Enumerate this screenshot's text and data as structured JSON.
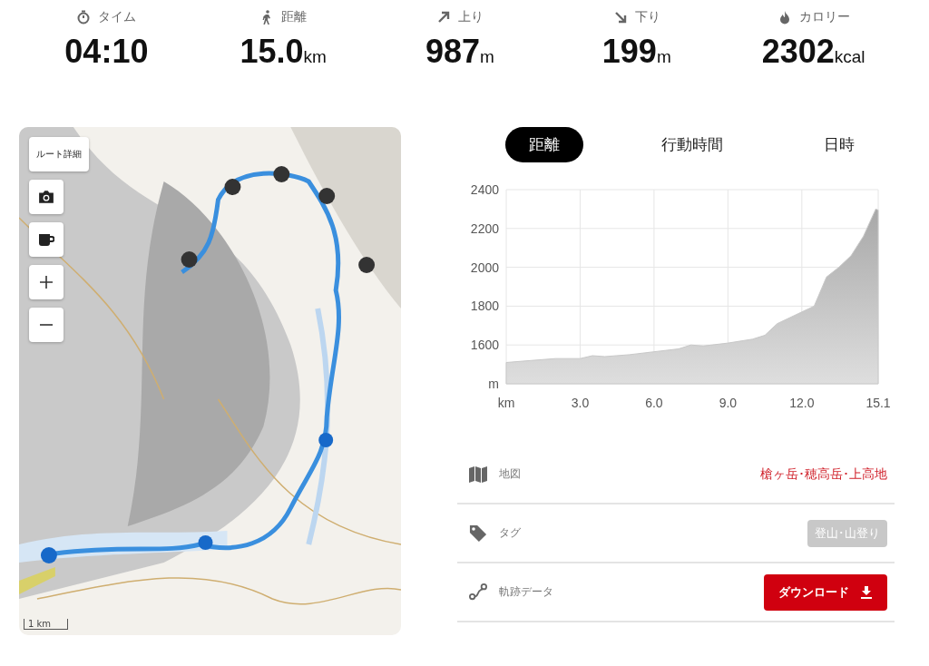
{
  "stats": [
    {
      "kind": "time",
      "label": "タイム",
      "value": "04:10"
    },
    {
      "kind": "distance",
      "label": "距離",
      "value": "15.0",
      "unit": "km"
    },
    {
      "kind": "ascent",
      "label": "上り",
      "value": "987",
      "unit": "m"
    },
    {
      "kind": "descent",
      "label": "下り",
      "value": "199",
      "unit": "m"
    },
    {
      "kind": "calorie",
      "label": "カロリー",
      "value": "2302",
      "unit": "kcal"
    }
  ],
  "map": {
    "controls": [
      {
        "kind": "text",
        "label": "ルート詳細"
      },
      {
        "kind": "camera"
      },
      {
        "kind": "cup"
      },
      {
        "kind": "zoom-in"
      },
      {
        "kind": "zoom-out"
      }
    ],
    "scale": "1 km"
  },
  "tabs": [
    {
      "label": "距離",
      "selected": true
    },
    {
      "label": "行動時間",
      "selected": false
    },
    {
      "label": "日時",
      "selected": false
    }
  ],
  "chart_data": {
    "type": "area",
    "x": [
      0,
      1,
      2,
      3,
      3.5,
      4,
      5,
      6,
      7,
      7.5,
      8,
      9,
      10,
      10.5,
      11,
      12,
      12.5,
      13,
      13.5,
      14,
      14.5,
      15,
      15.1
    ],
    "grid": true,
    "series": [
      {
        "color": "#c8c8c8",
        "values": [
          1510,
          1520,
          1530,
          1530,
          1545,
          1540,
          1550,
          1565,
          1580,
          1600,
          1595,
          1610,
          1630,
          1650,
          1710,
          1770,
          1800,
          1950,
          2000,
          2060,
          2160,
          2300,
          2295
        ]
      }
    ],
    "xlim": [
      0,
      15.1
    ],
    "ylim": [
      1400,
      2400
    ],
    "xticks": [
      {
        "value": 0,
        "label": "km"
      },
      {
        "value": 3,
        "label": "3.0"
      },
      {
        "value": 6,
        "label": "6.0"
      },
      {
        "value": 9,
        "label": "9.0"
      },
      {
        "value": 12,
        "label": "12.0"
      },
      {
        "value": 15.1,
        "label": "15.1"
      }
    ],
    "yticks": [
      {
        "value": 1400,
        "label": "m"
      },
      1600,
      1800,
      2000,
      2200,
      2400
    ]
  },
  "info": [
    {
      "kind": "link",
      "label": "地図",
      "value": "槍ヶ岳･穂高岳･上高地"
    },
    {
      "kind": "tag",
      "label": "タグ",
      "value": "登山･山登り"
    },
    {
      "kind": "download",
      "label": "軌跡データ",
      "value": "ダウンロード"
    }
  ]
}
